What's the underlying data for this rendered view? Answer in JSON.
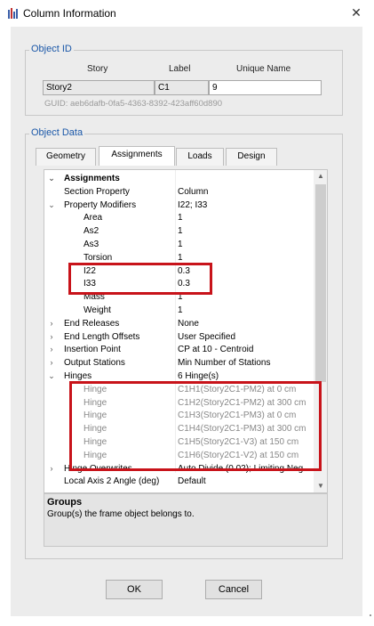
{
  "window": {
    "title": "Column Information",
    "close_glyph": "✕"
  },
  "object_id": {
    "group_title": "Object ID",
    "story_header": "Story",
    "label_header": "Label",
    "unique_name_header": "Unique Name",
    "story_value": "Story2",
    "label_value": "C1",
    "unique_name_value": "9",
    "guid_text": "GUID:  aeb6dafb-0fa5-4363-8392-423aff60d890"
  },
  "object_data": {
    "group_title": "Object Data",
    "tabs": [
      {
        "label": "Geometry"
      },
      {
        "label": "Assignments",
        "active": true
      },
      {
        "label": "Loads"
      },
      {
        "label": "Design"
      }
    ]
  },
  "rows": [
    {
      "exp": "⌄",
      "key": "Assignments",
      "value": ""
    },
    {
      "exp": "",
      "key": "Section Property",
      "value": "Column"
    },
    {
      "exp": "⌄",
      "key": "Property Modifiers",
      "value": "I22; I33"
    },
    {
      "exp": "",
      "key": "Area",
      "value": "1"
    },
    {
      "exp": "",
      "key": "As2",
      "value": "1"
    },
    {
      "exp": "",
      "key": "As3",
      "value": "1"
    },
    {
      "exp": "",
      "key": "Torsion",
      "value": "1"
    },
    {
      "exp": "",
      "key": "I22",
      "value": "0.3"
    },
    {
      "exp": "",
      "key": "I33",
      "value": "0.3"
    },
    {
      "exp": "",
      "key": "Mass",
      "value": "1"
    },
    {
      "exp": "",
      "key": "Weight",
      "value": "1"
    },
    {
      "exp": "›",
      "key": "End Releases",
      "value": "None"
    },
    {
      "exp": "›",
      "key": "End Length Offsets",
      "value": "User Specified"
    },
    {
      "exp": "›",
      "key": "Insertion Point",
      "value": "CP at 10 - Centroid"
    },
    {
      "exp": "›",
      "key": "Output Stations",
      "value": "Min Number of Stations"
    },
    {
      "exp": "⌄",
      "key": "Hinges",
      "value": "6 Hinge(s)"
    },
    {
      "exp": "",
      "key": "Hinge",
      "value": "C1H1(Story2C1-PM2) at 0 cm"
    },
    {
      "exp": "",
      "key": "Hinge",
      "value": "C1H2(Story2C1-PM2) at 300 cm"
    },
    {
      "exp": "",
      "key": "Hinge",
      "value": "C1H3(Story2C1-PM3) at 0 cm"
    },
    {
      "exp": "",
      "key": "Hinge",
      "value": "C1H4(Story2C1-PM3) at 300 cm"
    },
    {
      "exp": "",
      "key": "Hinge",
      "value": "C1H5(Story2C1-V3) at 150 cm"
    },
    {
      "exp": "",
      "key": "Hinge",
      "value": "C1H6(Story2C1-V2) at 150 cm"
    },
    {
      "exp": "›",
      "key": "Hinge Overwrites",
      "value": "Auto Divide (0.02); Limiting Neg"
    },
    {
      "exp": "",
      "key": "Local Axis 2 Angle (deg)",
      "value": "Default"
    }
  ],
  "scroll": {
    "up_glyph": "▲",
    "down_glyph": "▼"
  },
  "description": {
    "title": "Groups",
    "text": "Group(s) the frame object belongs to."
  },
  "buttons": {
    "ok": "OK",
    "cancel": "Cancel"
  },
  "colors": {
    "highlight": "#c8131a",
    "group_title": "#1a57a8"
  }
}
